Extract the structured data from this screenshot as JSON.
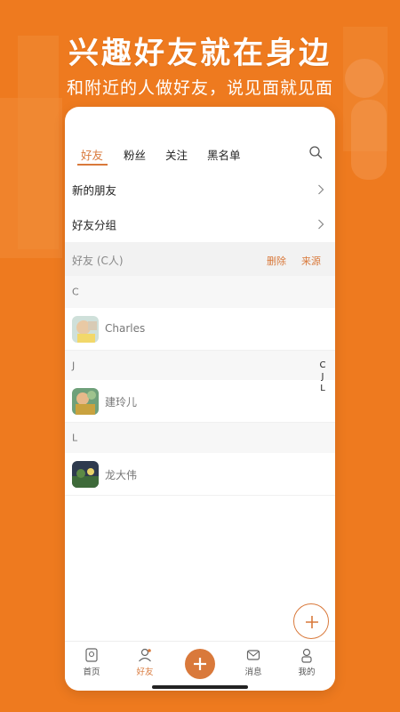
{
  "promo": {
    "headline": "兴趣好友就在身边",
    "subline": "和附近的人做好友，说见面就见面"
  },
  "tabs": [
    {
      "label": "好友",
      "active": true
    },
    {
      "label": "粉丝",
      "active": false
    },
    {
      "label": "关注",
      "active": false
    },
    {
      "label": "黑名单",
      "active": false
    }
  ],
  "menu": {
    "new_friends": "新的朋友",
    "friend_groups": "好友分组"
  },
  "friends_section": {
    "title": "好友 (C人)",
    "delete_label": "删除",
    "source_label": "来源"
  },
  "groups": [
    {
      "letter": "C",
      "friends": [
        {
          "name": "Charles"
        }
      ]
    },
    {
      "letter": "J",
      "friends": [
        {
          "name": "建玲儿"
        }
      ]
    },
    {
      "letter": "L",
      "friends": [
        {
          "name": "龙大伟"
        }
      ]
    }
  ],
  "index_letters": [
    "C",
    "J",
    "L"
  ],
  "nav": {
    "home": "首页",
    "friends": "好友",
    "messages": "消息",
    "me": "我的"
  },
  "colors": {
    "background": "#EE7A1F",
    "accent": "#D9793B"
  }
}
